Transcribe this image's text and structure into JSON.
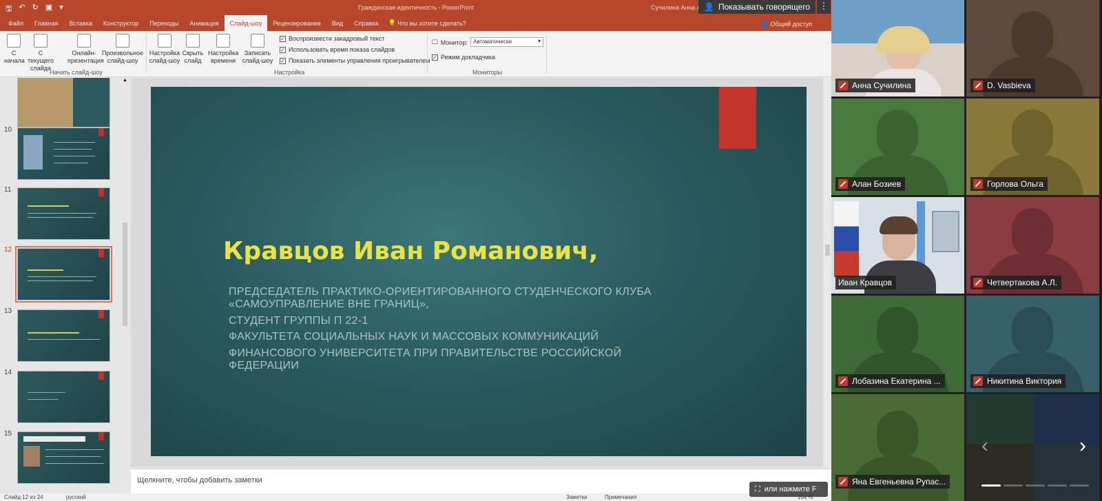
{
  "powerpoint": {
    "document_title": "Гражданская идентичность  -  PowerPoint",
    "user_name": "Сучилина Анна А...",
    "speaker_view_label": "Показывать говорящего",
    "more_icon": "⋮",
    "tabs": [
      {
        "label": "Файл"
      },
      {
        "label": "Главная"
      },
      {
        "label": "Вставка"
      },
      {
        "label": "Конструктор"
      },
      {
        "label": "Переходы"
      },
      {
        "label": "Анимация"
      },
      {
        "label": "Слайд-шоу",
        "active": true
      },
      {
        "label": "Рецензирование"
      },
      {
        "label": "Вид"
      },
      {
        "label": "Справка"
      }
    ],
    "tell_me": "Что вы хотите сделать?",
    "share": "Общий доступ",
    "ribbon": {
      "btn_from_start": "С начала",
      "btn_from_current": "С текущего слайда",
      "btn_online": "Онлайн-презентация",
      "btn_custom": "Произвольное слайд-шоу",
      "group_start": "Начать слайд-шоу",
      "btn_setup": "Настройка слайд-шоу",
      "btn_hide": "Скрыть слайд",
      "btn_rehearse": "Настройка времени",
      "btn_record": "Записать слайд-шоу",
      "chk_narration": "Воспроизвести закадровый текст",
      "chk_timings": "Использовать время показа слайдов",
      "chk_controls": "Показать элементы управления проигрывателем",
      "group_setup": "Настройка",
      "monitor_label": "Монитор:",
      "monitor_value": "Автоматически",
      "chk_presenter": "Режим докладчика",
      "group_monitors": "Мониторы"
    },
    "thumbnails": [
      {
        "num": "",
        "current": false
      },
      {
        "num": "10",
        "current": false
      },
      {
        "num": "11",
        "current": false
      },
      {
        "num": "12",
        "current": true
      },
      {
        "num": "13",
        "current": false
      },
      {
        "num": "14",
        "current": false
      },
      {
        "num": "15",
        "current": false
      }
    ],
    "slide": {
      "title": "Кравцов Иван Романович,",
      "lines": [
        "ПРЕДСЕДАТЕЛЬ ПРАКТИКО-ОРИЕНТИРОВАННОГО СТУДЕНЧЕСКОГО КЛУБА",
        "«САМОУПРАВЛЕНИЕ ВНЕ ГРАНИЦ»,",
        "СТУДЕНТ ГРУППЫ П 22-1",
        "ФАКУЛЬТЕТА СОЦИАЛЬНЫХ НАУК И МАССОВЫХ КОММУНИКАЦИЙ",
        "ФИНАНСОВОГО УНИВЕРСИТЕТА ПРИ ПРАВИТЕЛЬСТВЕ РОССИЙСКОЙ",
        "ФЕДЕРАЦИИ"
      ]
    },
    "notes_placeholder": "Щелкните, чтобы добавить заметки",
    "status": {
      "slide_counter": "Слайд 12 из 24",
      "language": "русский",
      "notes_btn": "Заметки",
      "comments_btn": "Примечания",
      "zoom": "104 %"
    },
    "overlay_hint": "или нажмите F"
  },
  "participants": [
    {
      "name": "Анна Сучилина",
      "video": true,
      "bg": "#c9b8a8"
    },
    {
      "name": "D. Vasbieva",
      "video": false,
      "bg": "#5e4a3a",
      "sil": "#4a3a2e"
    },
    {
      "name": "Алан Бозиев",
      "video": false,
      "bg": "#4b7a3e",
      "sil": "#3b6230"
    },
    {
      "name": "Горлова Ольга",
      "video": false,
      "bg": "#8a7a3a",
      "sil": "#6f622d"
    },
    {
      "name": "Иван Кравцов",
      "video": true,
      "active": true,
      "bg": "#d8dfe6"
    },
    {
      "name": "Четвертакова А.Л.",
      "video": false,
      "bg": "#8a3c40",
      "sil": "#6d2f33"
    },
    {
      "name": "Лобазина Екатерина ...",
      "video": false,
      "bg": "#3e6a38",
      "sil": "#30552b"
    },
    {
      "name": "Никитина Виктория",
      "video": false,
      "bg": "#36616a",
      "sil": "#2a4d55"
    },
    {
      "name": "Яна Евгеньевна Рупас...",
      "video": false,
      "bg": "#4a6b36",
      "sil": "#3a5629"
    }
  ],
  "grid_nav": {
    "prev": "‹",
    "next": "›"
  }
}
